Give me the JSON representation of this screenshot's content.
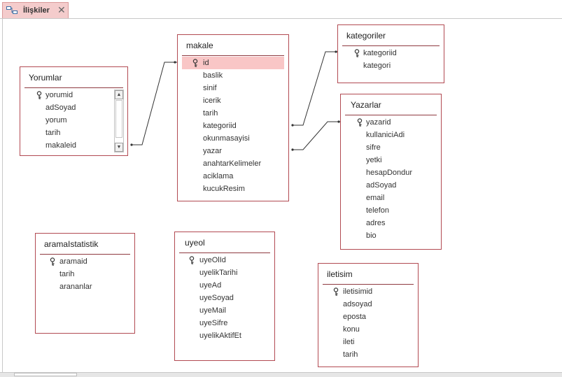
{
  "tab": {
    "label": "İlişkiler",
    "close": "✕"
  },
  "tables": {
    "yorumlar": {
      "title": "Yorumlar",
      "fields": [
        "yorumid",
        "adSoyad",
        "yorum",
        "tarih",
        "makaleid"
      ]
    },
    "makale": {
      "title": "makale",
      "fields": [
        "id",
        "baslik",
        "sinif",
        "icerik",
        "tarih",
        "kategoriid",
        "okunmasayisi",
        "yazar",
        "anahtarKelimeler",
        "aciklama",
        "kucukResim"
      ]
    },
    "kategoriler": {
      "title": "kategoriler",
      "fields": [
        "kategoriid",
        "kategori"
      ]
    },
    "yazarlar": {
      "title": "Yazarlar",
      "fields": [
        "yazarid",
        "kullaniciAdi",
        "sifre",
        "yetki",
        "hesapDondur",
        "adSoyad",
        "email",
        "telefon",
        "adres",
        "bio"
      ]
    },
    "aramalstatistik": {
      "title": "aramaIstatistik",
      "fields": [
        "aramaid",
        "tarih",
        "arananlar"
      ]
    },
    "uyeol": {
      "title": "uyeol",
      "fields": [
        "uyeOlId",
        "uyelikTarihi",
        "uyeAd",
        "uyeSoyad",
        "uyeMail",
        "uyeSifre",
        "uyelikAktifEt"
      ]
    },
    "iletisim": {
      "title": "iletisim",
      "fields": [
        "iletisimid",
        "adsoyad",
        "eposta",
        "konu",
        "ileti",
        "tarih"
      ]
    }
  },
  "colors": {
    "tableBorder": "#b24a52",
    "selectedRow": "#f9c6c6",
    "tabBackground": "#f4cccc"
  }
}
